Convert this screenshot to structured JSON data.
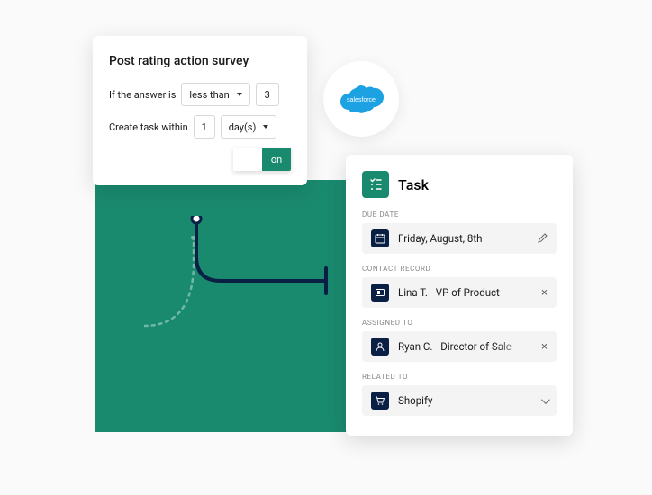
{
  "survey": {
    "title": "Post rating action survey",
    "condition_label": "If the answer is",
    "operator": "less than",
    "threshold": "3",
    "create_label": "Create task within",
    "duration_value": "1",
    "duration_unit": "day(s)",
    "toggle_on": "on"
  },
  "salesforce": {
    "label": "salesforce"
  },
  "task": {
    "title": "Task",
    "fields": {
      "due_date": {
        "label": "DUE DATE",
        "value": "Friday, August, 8th"
      },
      "contact_record": {
        "label": "CONTACT RECORD",
        "value": "Lina T. - VP of Product"
      },
      "assigned_to": {
        "label": "ASSIGNED TO",
        "value": "Ryan C. - Director of Sale"
      },
      "related_to": {
        "label": "RELATED TO",
        "value": "Shopify"
      }
    }
  }
}
